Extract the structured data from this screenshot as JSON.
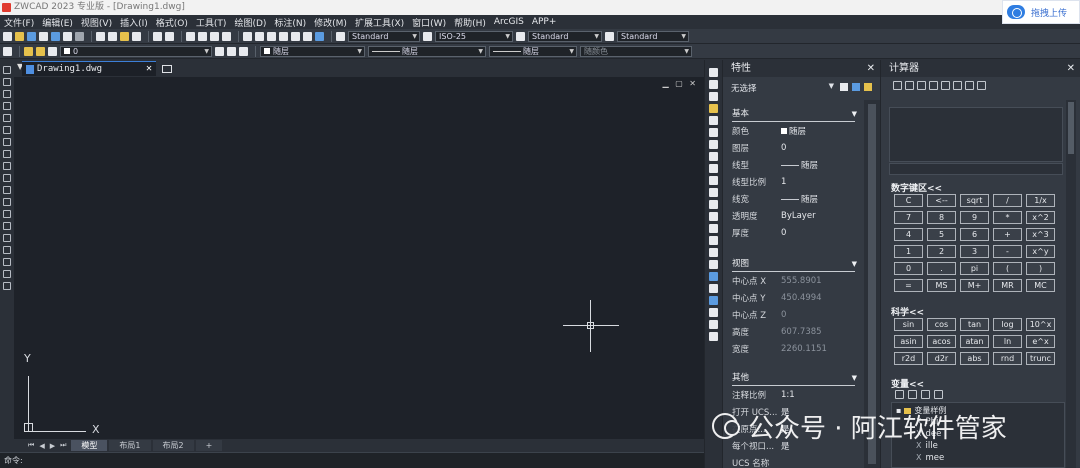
{
  "window": {
    "title": "ZWCAD 2023 专业版 - [Drawing1.dwg]",
    "upload_label": "拖拽上传"
  },
  "menu": [
    "文件(F)",
    "编辑(E)",
    "视图(V)",
    "插入(I)",
    "格式(O)",
    "工具(T)",
    "绘图(D)",
    "标注(N)",
    "修改(M)",
    "扩展工具(X)",
    "窗口(W)",
    "帮助(H)",
    "ArcGIS",
    "APP+"
  ],
  "toolbar1": {
    "text_style": "Standard",
    "dim_style": "ISO-25",
    "table_style": "Standard",
    "mleader_style": "Standard"
  },
  "toolbar2": {
    "layer": "0",
    "color": "随层",
    "linetype": "随层",
    "lineweight": "随层",
    "plotstyle": "随颜色"
  },
  "document": {
    "tab": "Drawing1.dwg",
    "axis_x": "X",
    "axis_y": "Y"
  },
  "layout_tabs": [
    "模型",
    "布局1",
    "布局2",
    "+"
  ],
  "command_prompt": "命令:",
  "properties": {
    "title": "特性",
    "selection": "无选择",
    "sections": {
      "basic": {
        "title": "基本",
        "rows": [
          {
            "key": "颜色",
            "value": "随层"
          },
          {
            "key": "图层",
            "value": "0"
          },
          {
            "key": "线型",
            "value": "随层"
          },
          {
            "key": "线型比例",
            "value": "1"
          },
          {
            "key": "线宽",
            "value": "随层"
          },
          {
            "key": "透明度",
            "value": "ByLayer"
          },
          {
            "key": "厚度",
            "value": "0"
          }
        ]
      },
      "view": {
        "title": "视图",
        "rows": [
          {
            "key": "中心点 X",
            "value": "555.8901"
          },
          {
            "key": "中心点 Y",
            "value": "450.4994"
          },
          {
            "key": "中心点 Z",
            "value": "0"
          },
          {
            "key": "高度",
            "value": "607.7385"
          },
          {
            "key": "宽度",
            "value": "2260.1151"
          }
        ]
      },
      "other": {
        "title": "其他",
        "rows": [
          {
            "key": "注释比例",
            "value": "1:1"
          },
          {
            "key": "打开 UCS...",
            "value": "是"
          },
          {
            "key": "在原点...",
            "value": "是"
          },
          {
            "key": "每个视口...",
            "value": "是"
          },
          {
            "key": "UCS 名称",
            "value": ""
          }
        ]
      }
    }
  },
  "calculator": {
    "title": "计算器",
    "numpad_title": "数字键区<<",
    "numpad_keys": [
      "C",
      "<--",
      "sqrt",
      "/",
      "1/x",
      "7",
      "8",
      "9",
      "*",
      "x^2",
      "4",
      "5",
      "6",
      "+",
      "x^3",
      "1",
      "2",
      "3",
      "-",
      "x^y",
      "0",
      ".",
      "pi",
      "(",
      ")",
      "=",
      "MS",
      "M+",
      "MR",
      "MC"
    ],
    "sci_title": "科学<<",
    "sci_keys": [
      "sin",
      "cos",
      "tan",
      "log",
      "10^x",
      "asin",
      "acos",
      "atan",
      "ln",
      "e^x",
      "r2d",
      "d2r",
      "abs",
      "rnd",
      "trunc"
    ],
    "vars_title": "变量<<",
    "vars_group": "变量样例",
    "vars": [
      "Phi",
      "dee",
      "ille",
      "mee"
    ]
  },
  "watermark": "公众号 · 阿江软件管家"
}
